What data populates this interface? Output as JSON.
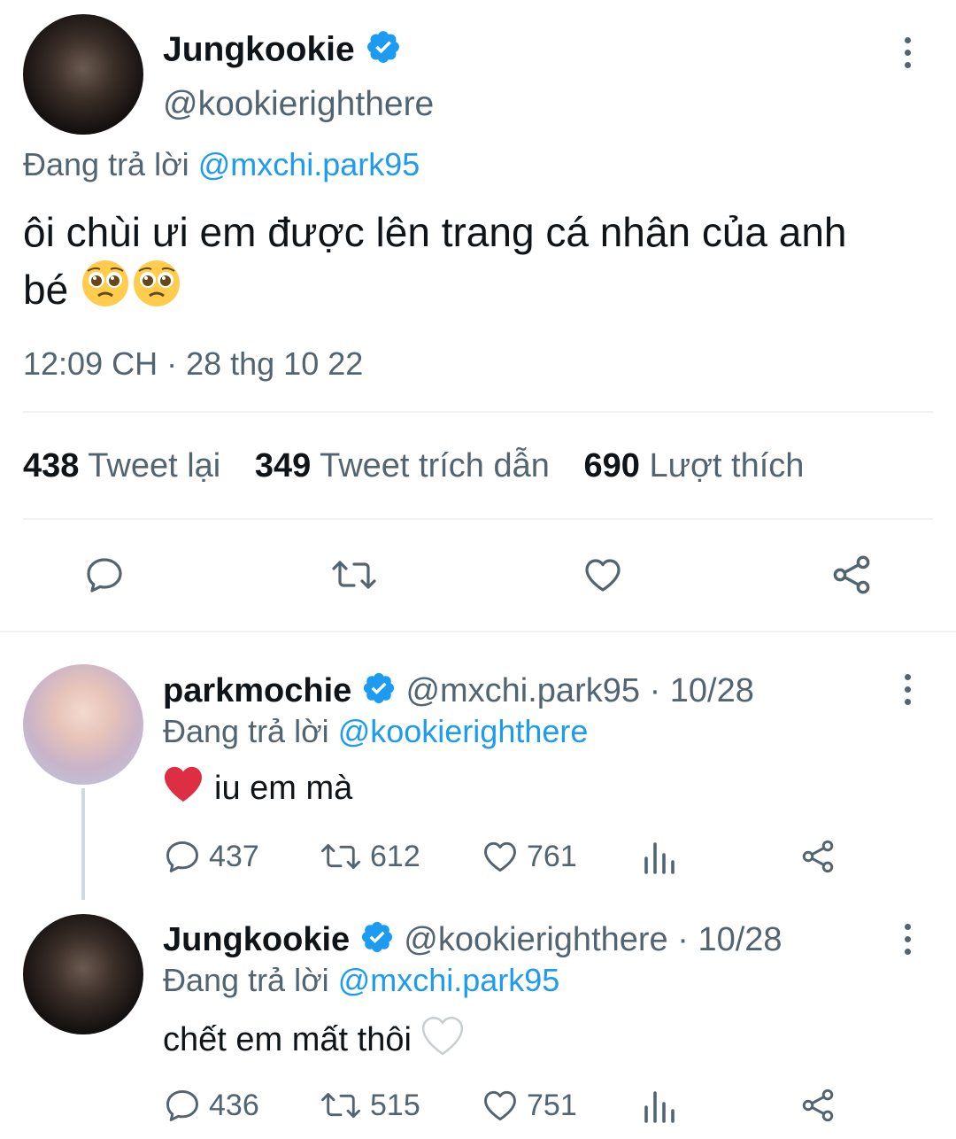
{
  "main_tweet": {
    "display_name": "Jungkookie",
    "handle": "@kookierighthere",
    "reply_prefix": "Đang trả lời",
    "reply_to": "@mxchi.park95",
    "text_line1": "ôi chùi ưi em được lên trang cá nhân của anh",
    "text_line2": "bé",
    "emojis": [
      "pleading-face",
      "pleading-face"
    ],
    "timestamp": "12:09 CH · 28 thg 10 22",
    "stats": {
      "retweets_count": "438",
      "retweets_label": "Tweet lại",
      "quotes_count": "349",
      "quotes_label": "Tweet trích dẫn",
      "likes_count": "690",
      "likes_label": "Lượt thích"
    },
    "actions": [
      "reply-icon",
      "retweet-icon",
      "like-icon",
      "share-icon"
    ]
  },
  "replies": [
    {
      "display_name": "parkmochie",
      "handle": "@mxchi.park95",
      "date": "· 10/28",
      "reply_prefix": "Đang trả lời",
      "reply_to": "@kookierighthere",
      "text": "iu em mà",
      "leading_emoji": "red-heart",
      "reply_count": "437",
      "retweet_count": "612",
      "like_count": "761"
    },
    {
      "display_name": "Jungkookie",
      "handle": "@kookierighthere",
      "date": "· 10/28",
      "reply_prefix": "Đang trả lời",
      "reply_to": "@mxchi.park95",
      "text": "chết em mất thôi",
      "trailing_emoji": "white-heart",
      "reply_count": "436",
      "retweet_count": "515",
      "like_count": "751"
    }
  ],
  "colors": {
    "accent": "#1d9bf0",
    "text": "#0f1419",
    "secondary": "#536471",
    "divider": "#eff3f4"
  }
}
